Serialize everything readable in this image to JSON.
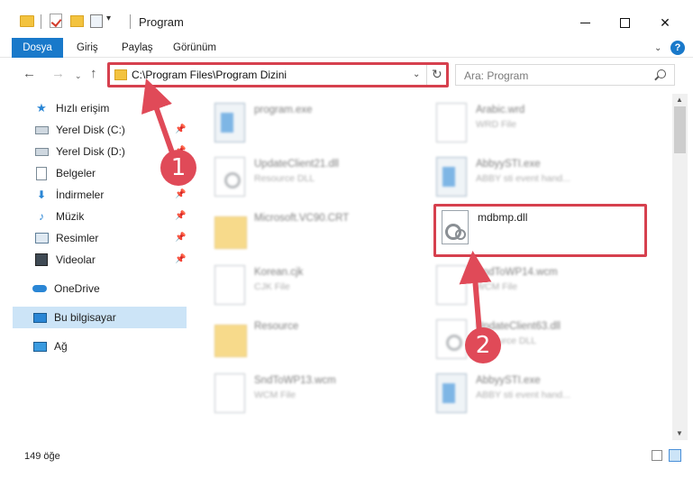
{
  "window": {
    "title": "Program",
    "minimize_glyph": "",
    "maximize_glyph": "",
    "close_glyph": "✕"
  },
  "ribbon": {
    "tabs": [
      {
        "label": "Dosya"
      },
      {
        "label": "Giriş"
      },
      {
        "label": "Paylaş"
      },
      {
        "label": "Görünüm"
      }
    ],
    "help_glyph": "?"
  },
  "nav": {
    "back_glyph": "←",
    "forward_glyph": "→",
    "recent_glyph": "⌄",
    "up_glyph": "↑",
    "address_path": "C:\\Program Files\\Program Dizini",
    "dropdown_glyph": "⌄",
    "refresh_glyph": "↻"
  },
  "search": {
    "placeholder": "Ara: Program"
  },
  "sidebar": {
    "pin_glyph": "📌",
    "items": [
      {
        "label": "Hızlı erişim",
        "icon": "star-icon"
      },
      {
        "label": "Yerel Disk (C:)",
        "icon": "drive-icon",
        "pinned": true
      },
      {
        "label": "Yerel Disk (D:)",
        "icon": "drive-icon",
        "pinned": true
      },
      {
        "label": "Belgeler",
        "icon": "documents-icon",
        "pinned": true
      },
      {
        "label": "İndirmeler",
        "icon": "download-icon",
        "pinned": true
      },
      {
        "label": "Müzik",
        "icon": "music-icon",
        "pinned": true
      },
      {
        "label": "Resimler",
        "icon": "pictures-icon",
        "pinned": true
      },
      {
        "label": "Videolar",
        "icon": "videos-icon",
        "pinned": true
      },
      {
        "label": "OneDrive",
        "icon": "onedrive-icon"
      },
      {
        "label": "Bu bilgisayar",
        "icon": "computer-icon",
        "selected": true
      },
      {
        "label": "Ağ",
        "icon": "network-icon"
      }
    ]
  },
  "files": [
    {
      "name": "program.exe",
      "type": "",
      "icon": "exe"
    },
    {
      "name": "Arabic.wrd",
      "type": "WRD File",
      "icon": "file"
    },
    {
      "name": "UpdateClient21.dll",
      "type": "Resource DLL",
      "icon": "gear"
    },
    {
      "name": "AbbyySTI.exe",
      "type": "ABBY sti event hand...",
      "icon": "exe"
    },
    {
      "name": "Microsoft.VC90.CRT",
      "type": "",
      "icon": "folder"
    },
    {
      "name": "Korean.cjk",
      "type": "CJK File",
      "icon": "file"
    },
    {
      "name": "SndToWP14.wcm",
      "type": "WCM File",
      "icon": "file"
    },
    {
      "name": "Resource",
      "type": "",
      "icon": "folder"
    },
    {
      "name": "UpdateClient63.dll",
      "type": "Resource DLL",
      "icon": "gear"
    },
    {
      "name": "SndToWP13.wcm",
      "type": "WCM File",
      "icon": "file"
    },
    {
      "name": "AbbyySTI.exe",
      "type": "ABBY sti event hand...",
      "icon": "exe"
    }
  ],
  "highlighted_file": {
    "name": "mdbmp.dll"
  },
  "callouts": {
    "one": "1",
    "two": "2"
  },
  "colors": {
    "accent": "#1979ca",
    "highlight": "#d6404e",
    "callout": "#e04a58"
  },
  "scrollbar": {
    "up_glyph": "▲",
    "down_glyph": "▼"
  },
  "status": {
    "item_count": "149 öğe"
  }
}
